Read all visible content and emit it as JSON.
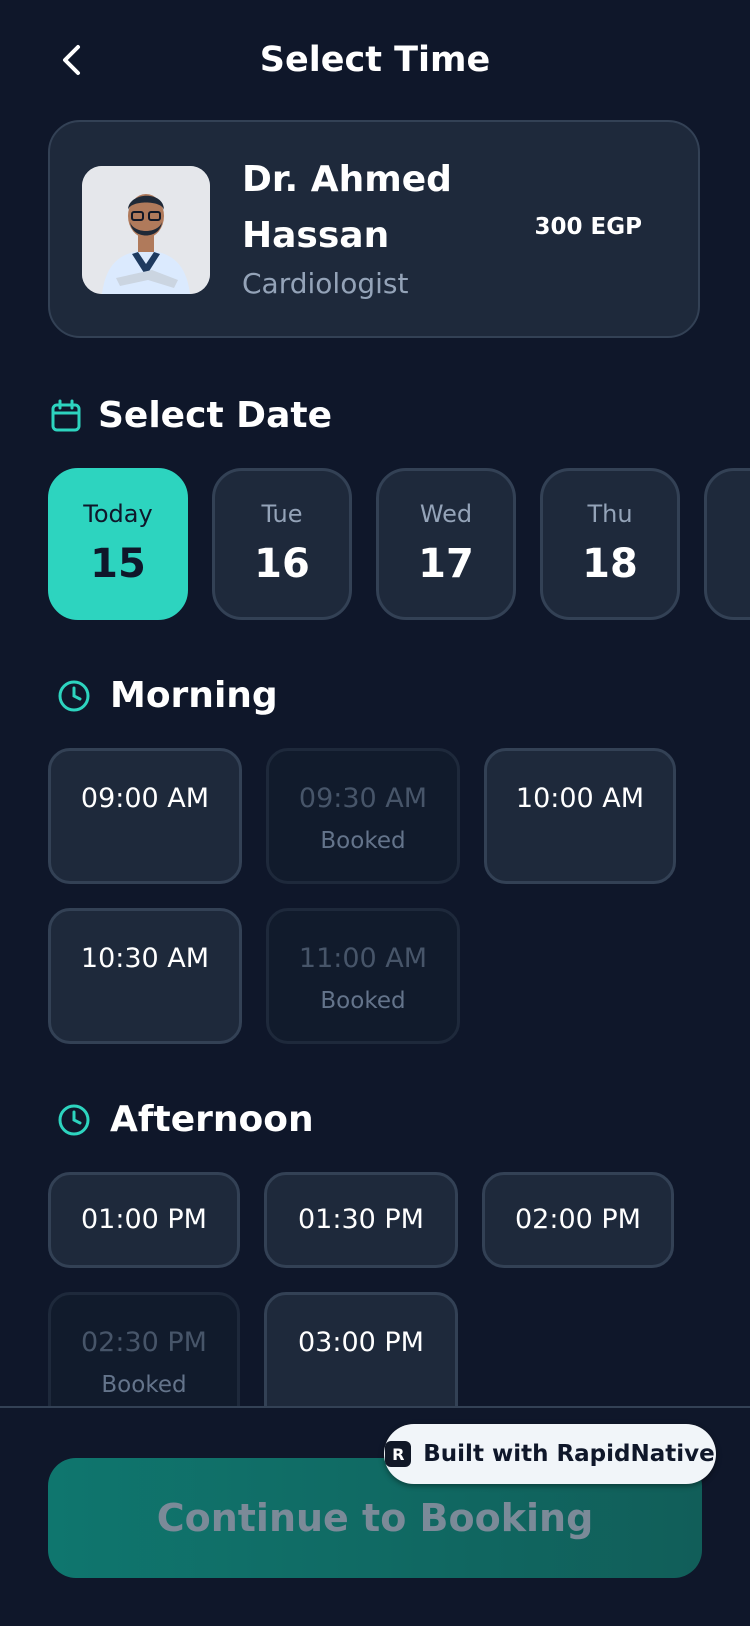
{
  "header": {
    "title": "Select Time",
    "back_icon": "chevron-left-icon"
  },
  "doctor": {
    "name": "Dr. Ahmed Hassan",
    "specialty": "Cardiologist",
    "price": "300 EGP"
  },
  "dates": {
    "title": "Select Date",
    "icon": "calendar-icon",
    "items": [
      {
        "day": "Today",
        "num": "15",
        "selected": true
      },
      {
        "day": "Tue",
        "num": "16"
      },
      {
        "day": "Wed",
        "num": "17"
      },
      {
        "day": "Thu",
        "num": "18"
      }
    ]
  },
  "morning": {
    "title": "Morning",
    "icon": "clock-icon",
    "slots": [
      {
        "time": "09:00 AM",
        "note": ""
      },
      {
        "time": "09:30 AM",
        "note": "Booked"
      },
      {
        "time": "10:00 AM",
        "note": ""
      },
      {
        "time": "10:30 AM",
        "note": ""
      },
      {
        "time": "11:00 AM",
        "note": "Booked"
      }
    ]
  },
  "afternoon": {
    "title": "Afternoon",
    "icon": "clock-icon",
    "slots": [
      {
        "time": "01:00 PM",
        "note": ""
      },
      {
        "time": "01:30 PM",
        "note": ""
      },
      {
        "time": "02:00 PM",
        "note": ""
      },
      {
        "time": "02:30 PM",
        "note": "Booked"
      },
      {
        "time": "03:00 PM",
        "note": ""
      }
    ]
  },
  "footer": {
    "continue_label": "Continue to Booking",
    "badge_label": "Built with RapidNative"
  },
  "colors": {
    "background": "#0f172a",
    "card": "#1e293b",
    "accent": "#2dd4bf",
    "button": "#0f766e"
  }
}
